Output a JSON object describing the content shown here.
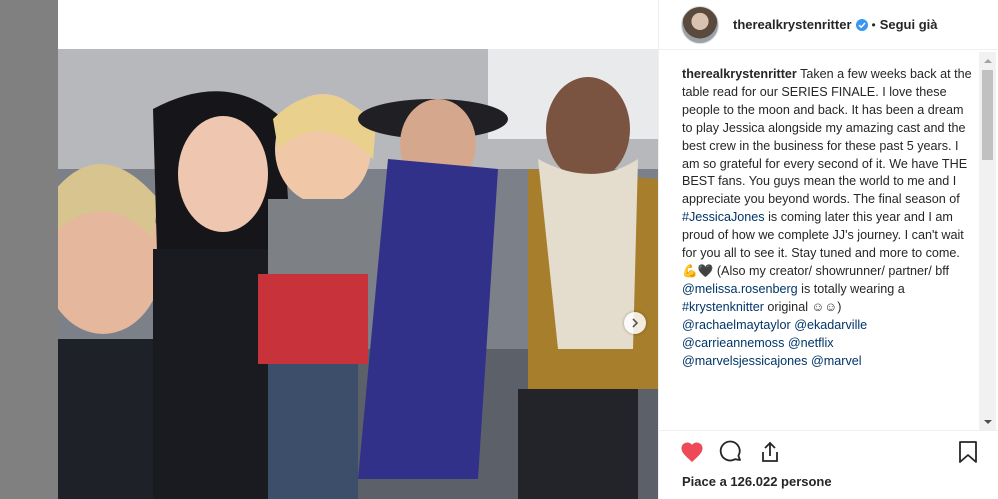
{
  "post": {
    "username": "therealkrystenritter",
    "follow_label": "Segui già",
    "caption_user": "therealkrystenritter",
    "caption_text_1": " Taken a few weeks back at the table read for our SERIES FINALE. I love these people to the moon and back. It has been a dream to play Jessica alongside my amazing cast and the best crew in the business for these past 5 years. I am so grateful for every second of it. We have THE BEST fans. You guys mean the world to me and I appreciate you beyond words. The final season of ",
    "hashtag_1": "#JessicaJones",
    "caption_text_2": " is coming later this year and I am proud of how we complete JJ's journey. I can't wait for you all to see it. Stay tuned and more to come. 💪🖤 (Also my creator/ showrunner/ partner/ bff ",
    "mention_1": "@melissa.rosenberg",
    "caption_text_3": " is totally wearing a ",
    "hashtag_2": "#krystenknitter",
    "caption_text_4": " original ☺☺)",
    "mention_2": "@rachaelmaytaylor",
    "mention_3": "@ekadarville",
    "mention_4": "@carrieannemoss",
    "mention_5": "@netflix",
    "mention_6": "@marvelsjessicajones",
    "mention_7": "@marvel",
    "likes_label": "Piace a 126.022 persone"
  },
  "icons": {
    "like": "heart-icon",
    "comment": "comment-icon",
    "share": "share-icon",
    "save": "bookmark-icon",
    "next": "chevron-right-icon",
    "verified": "verified-badge-icon"
  },
  "colors": {
    "like_red": "#ed4956",
    "link_blue": "#003569",
    "verified_blue": "#3897f0"
  }
}
